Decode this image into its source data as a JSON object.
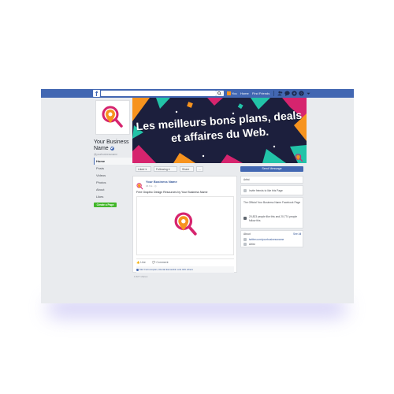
{
  "topbar": {
    "logo": "f",
    "user_name": "You",
    "links": [
      "Home",
      "Find Friends"
    ],
    "icons": [
      "friends-icon",
      "messages-icon",
      "notifications-icon",
      "help-icon",
      "menu-arrow-icon"
    ]
  },
  "page": {
    "name": "Your Business Name",
    "handle": "@yourbusinessname",
    "nav": [
      "Home",
      "Posts",
      "Videos",
      "Photos",
      "About",
      "Likes"
    ],
    "create_page_label": "Create a Page"
  },
  "cover": {
    "headline": "Les meilleurs bons plans, deals et affaires du Web."
  },
  "actions": {
    "liked": "Liked ▾",
    "following": "Following ▾",
    "share": "Share",
    "more": "...",
    "send_message": "Send Message"
  },
  "post": {
    "author": "Your Business Name",
    "time": "16 hrs · ◎",
    "text": "Free Graphic Design Resources by Your Business Name",
    "like_label": "Like",
    "comment_label": "Comment",
    "reactions": "Mel Cornucopian, Rental Escorabin and 426 others",
    "shares": "1,527 shares"
  },
  "sidebar": {
    "category": "Artist",
    "invite": "Invite friends to like this Page",
    "official": "The Official Your Business Name Facebook Page",
    "likes": "20,823 people like this and 20,774 people follow this",
    "about_label": "About",
    "see_all": "See All",
    "twitter": "twitter.com/yourbusinessname",
    "category2": "Artist"
  },
  "colors": {
    "facebook_blue": "#4267b2",
    "brand_orange": "#f7931e",
    "brand_magenta": "#d6246e",
    "cover_bg": "#1c1f3d",
    "green": "#42b72a"
  }
}
